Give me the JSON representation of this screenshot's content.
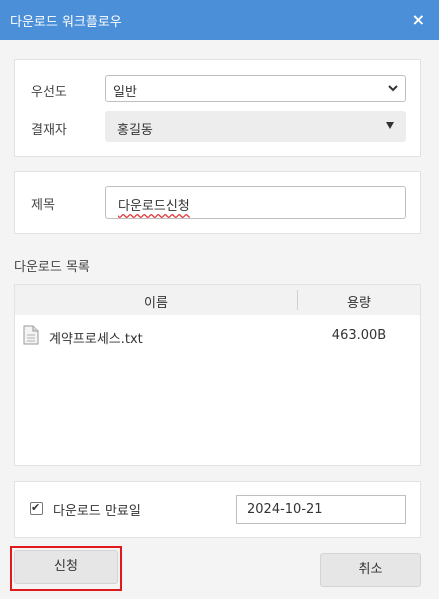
{
  "window": {
    "title": "다운로드 워크플로우",
    "close_icon": "×"
  },
  "form": {
    "priority_label": "우선도",
    "priority_value": "일반",
    "approver_label": "결재자",
    "approver_value": "홍길동",
    "subject_label": "제목",
    "subject_value": "다운로드신청"
  },
  "download_list": {
    "section_title": "다운로드 목록",
    "columns": [
      "이름",
      "용량"
    ],
    "files": [
      {
        "name": "계약프로세스.txt",
        "size": "463.00B",
        "icon": "document-icon"
      }
    ]
  },
  "expiry": {
    "checked": true,
    "label": "다운로드 만료일",
    "date": "2024-10-21"
  },
  "buttons": {
    "apply": "신청",
    "cancel": "취소"
  },
  "colors": {
    "titlebar": "#4a8fd8",
    "highlight_outline": "#e01a1a"
  }
}
